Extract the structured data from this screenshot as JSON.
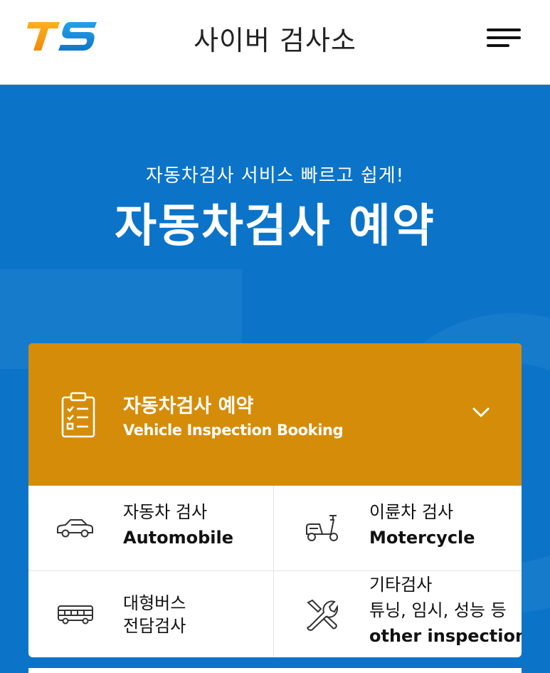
{
  "header": {
    "logo_text": "TS",
    "app_title": "사이버 검사소"
  },
  "hero": {
    "subtitle": "자동차검사 서비스 빠르고 쉽게!",
    "title": "자동차검사 예약"
  },
  "booking_card": {
    "title": "자동차검사 예약",
    "subtitle": "Vehicle Inspection Booking",
    "accent_color": "#d58c08",
    "items": [
      {
        "label_ko": "자동차 검사",
        "label_en": "Automobile",
        "icon": "car-icon"
      },
      {
        "label_ko": "이륜차 검사",
        "label_en": "Motercycle",
        "icon": "scooter-icon"
      },
      {
        "label_ko_1": "대형버스",
        "label_ko_2": "전담검사",
        "icon": "bus-icon"
      },
      {
        "label_ko_1": "기타검사",
        "label_ko_2": "튜닝, 임시, 성능 등",
        "label_en": "other inspection",
        "icon": "tools-icon"
      }
    ]
  },
  "colors": {
    "hero_background": "#0b74c9",
    "logo_orange": "#f5a016",
    "logo_blue": "#1a8ad8"
  }
}
